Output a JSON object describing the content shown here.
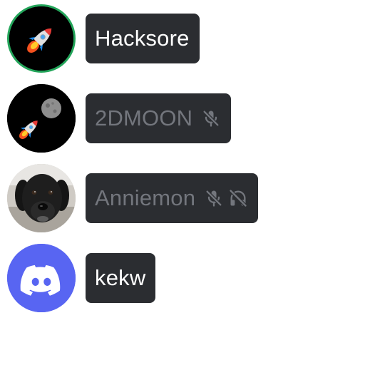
{
  "users": [
    {
      "name": "Hacksore",
      "avatar_icon": "rocket-icon",
      "speaking": true,
      "muted": false,
      "deafened": false
    },
    {
      "name": "2DMOON",
      "avatar_icon": "rocket-moon-icon",
      "speaking": false,
      "muted": true,
      "deafened": false
    },
    {
      "name": "Anniemon",
      "avatar_icon": "dog-photo",
      "speaking": false,
      "muted": true,
      "deafened": true
    },
    {
      "name": "kekw",
      "avatar_icon": "discord-logo-icon",
      "speaking": false,
      "muted": false,
      "deafened": false
    }
  ],
  "colors": {
    "speaking_ring": "#23a55a",
    "pill_bg": "#2b2d31",
    "name_active": "#ffffff",
    "name_dim": "#73767d",
    "discord_blurple": "#5865f2"
  }
}
